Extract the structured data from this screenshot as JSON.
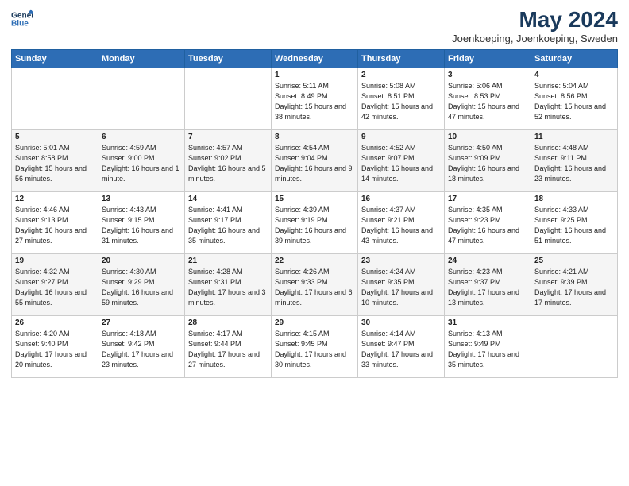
{
  "header": {
    "logo_line1": "General",
    "logo_line2": "Blue",
    "month_title": "May 2024",
    "location": "Joenkoeping, Joenkoeping, Sweden"
  },
  "days_of_week": [
    "Sunday",
    "Monday",
    "Tuesday",
    "Wednesday",
    "Thursday",
    "Friday",
    "Saturday"
  ],
  "weeks": [
    [
      {
        "day": "",
        "sunrise": "",
        "sunset": "",
        "daylight": ""
      },
      {
        "day": "",
        "sunrise": "",
        "sunset": "",
        "daylight": ""
      },
      {
        "day": "",
        "sunrise": "",
        "sunset": "",
        "daylight": ""
      },
      {
        "day": "1",
        "sunrise": "Sunrise: 5:11 AM",
        "sunset": "Sunset: 8:49 PM",
        "daylight": "Daylight: 15 hours and 38 minutes."
      },
      {
        "day": "2",
        "sunrise": "Sunrise: 5:08 AM",
        "sunset": "Sunset: 8:51 PM",
        "daylight": "Daylight: 15 hours and 42 minutes."
      },
      {
        "day": "3",
        "sunrise": "Sunrise: 5:06 AM",
        "sunset": "Sunset: 8:53 PM",
        "daylight": "Daylight: 15 hours and 47 minutes."
      },
      {
        "day": "4",
        "sunrise": "Sunrise: 5:04 AM",
        "sunset": "Sunset: 8:56 PM",
        "daylight": "Daylight: 15 hours and 52 minutes."
      }
    ],
    [
      {
        "day": "5",
        "sunrise": "Sunrise: 5:01 AM",
        "sunset": "Sunset: 8:58 PM",
        "daylight": "Daylight: 15 hours and 56 minutes."
      },
      {
        "day": "6",
        "sunrise": "Sunrise: 4:59 AM",
        "sunset": "Sunset: 9:00 PM",
        "daylight": "Daylight: 16 hours and 1 minute."
      },
      {
        "day": "7",
        "sunrise": "Sunrise: 4:57 AM",
        "sunset": "Sunset: 9:02 PM",
        "daylight": "Daylight: 16 hours and 5 minutes."
      },
      {
        "day": "8",
        "sunrise": "Sunrise: 4:54 AM",
        "sunset": "Sunset: 9:04 PM",
        "daylight": "Daylight: 16 hours and 9 minutes."
      },
      {
        "day": "9",
        "sunrise": "Sunrise: 4:52 AM",
        "sunset": "Sunset: 9:07 PM",
        "daylight": "Daylight: 16 hours and 14 minutes."
      },
      {
        "day": "10",
        "sunrise": "Sunrise: 4:50 AM",
        "sunset": "Sunset: 9:09 PM",
        "daylight": "Daylight: 16 hours and 18 minutes."
      },
      {
        "day": "11",
        "sunrise": "Sunrise: 4:48 AM",
        "sunset": "Sunset: 9:11 PM",
        "daylight": "Daylight: 16 hours and 23 minutes."
      }
    ],
    [
      {
        "day": "12",
        "sunrise": "Sunrise: 4:46 AM",
        "sunset": "Sunset: 9:13 PM",
        "daylight": "Daylight: 16 hours and 27 minutes."
      },
      {
        "day": "13",
        "sunrise": "Sunrise: 4:43 AM",
        "sunset": "Sunset: 9:15 PM",
        "daylight": "Daylight: 16 hours and 31 minutes."
      },
      {
        "day": "14",
        "sunrise": "Sunrise: 4:41 AM",
        "sunset": "Sunset: 9:17 PM",
        "daylight": "Daylight: 16 hours and 35 minutes."
      },
      {
        "day": "15",
        "sunrise": "Sunrise: 4:39 AM",
        "sunset": "Sunset: 9:19 PM",
        "daylight": "Daylight: 16 hours and 39 minutes."
      },
      {
        "day": "16",
        "sunrise": "Sunrise: 4:37 AM",
        "sunset": "Sunset: 9:21 PM",
        "daylight": "Daylight: 16 hours and 43 minutes."
      },
      {
        "day": "17",
        "sunrise": "Sunrise: 4:35 AM",
        "sunset": "Sunset: 9:23 PM",
        "daylight": "Daylight: 16 hours and 47 minutes."
      },
      {
        "day": "18",
        "sunrise": "Sunrise: 4:33 AM",
        "sunset": "Sunset: 9:25 PM",
        "daylight": "Daylight: 16 hours and 51 minutes."
      }
    ],
    [
      {
        "day": "19",
        "sunrise": "Sunrise: 4:32 AM",
        "sunset": "Sunset: 9:27 PM",
        "daylight": "Daylight: 16 hours and 55 minutes."
      },
      {
        "day": "20",
        "sunrise": "Sunrise: 4:30 AM",
        "sunset": "Sunset: 9:29 PM",
        "daylight": "Daylight: 16 hours and 59 minutes."
      },
      {
        "day": "21",
        "sunrise": "Sunrise: 4:28 AM",
        "sunset": "Sunset: 9:31 PM",
        "daylight": "Daylight: 17 hours and 3 minutes."
      },
      {
        "day": "22",
        "sunrise": "Sunrise: 4:26 AM",
        "sunset": "Sunset: 9:33 PM",
        "daylight": "Daylight: 17 hours and 6 minutes."
      },
      {
        "day": "23",
        "sunrise": "Sunrise: 4:24 AM",
        "sunset": "Sunset: 9:35 PM",
        "daylight": "Daylight: 17 hours and 10 minutes."
      },
      {
        "day": "24",
        "sunrise": "Sunrise: 4:23 AM",
        "sunset": "Sunset: 9:37 PM",
        "daylight": "Daylight: 17 hours and 13 minutes."
      },
      {
        "day": "25",
        "sunrise": "Sunrise: 4:21 AM",
        "sunset": "Sunset: 9:39 PM",
        "daylight": "Daylight: 17 hours and 17 minutes."
      }
    ],
    [
      {
        "day": "26",
        "sunrise": "Sunrise: 4:20 AM",
        "sunset": "Sunset: 9:40 PM",
        "daylight": "Daylight: 17 hours and 20 minutes."
      },
      {
        "day": "27",
        "sunrise": "Sunrise: 4:18 AM",
        "sunset": "Sunset: 9:42 PM",
        "daylight": "Daylight: 17 hours and 23 minutes."
      },
      {
        "day": "28",
        "sunrise": "Sunrise: 4:17 AM",
        "sunset": "Sunset: 9:44 PM",
        "daylight": "Daylight: 17 hours and 27 minutes."
      },
      {
        "day": "29",
        "sunrise": "Sunrise: 4:15 AM",
        "sunset": "Sunset: 9:45 PM",
        "daylight": "Daylight: 17 hours and 30 minutes."
      },
      {
        "day": "30",
        "sunrise": "Sunrise: 4:14 AM",
        "sunset": "Sunset: 9:47 PM",
        "daylight": "Daylight: 17 hours and 33 minutes."
      },
      {
        "day": "31",
        "sunrise": "Sunrise: 4:13 AM",
        "sunset": "Sunset: 9:49 PM",
        "daylight": "Daylight: 17 hours and 35 minutes."
      },
      {
        "day": "",
        "sunrise": "",
        "sunset": "",
        "daylight": ""
      }
    ]
  ]
}
